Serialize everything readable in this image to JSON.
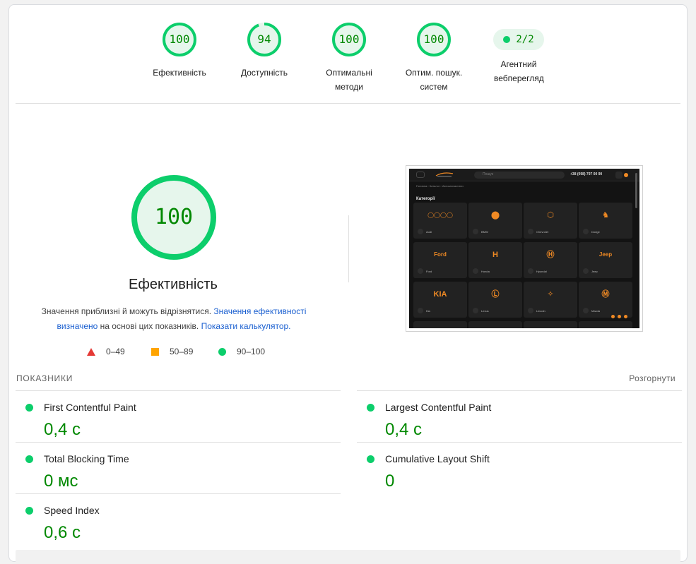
{
  "colors": {
    "pass": "#0cce6b",
    "pass_text": "#008800",
    "average": "#ffa400",
    "fail": "#e53935",
    "link": "#1a5fd0"
  },
  "gauges": [
    {
      "score": "100",
      "label": "Ефективність",
      "progress": 1.0
    },
    {
      "score": "94",
      "label": "Доступність",
      "progress": 0.94
    },
    {
      "score": "100",
      "label": "Оптимальні методи",
      "progress": 1.0
    },
    {
      "score": "100",
      "label": "Оптим. пошук. систем",
      "progress": 1.0
    }
  ],
  "agentic": {
    "value": "2/2",
    "label": "Агентний вебперегляд"
  },
  "main": {
    "score": "100",
    "title": "Ефективність",
    "desc_text1": "Значення приблизні й можуть відрізнятися.",
    "desc_link1": "Значення ефективності визначено",
    "desc_text2": "на основі цих показників.",
    "desc_link2": "Показати калькулятор."
  },
  "legend": {
    "fail": "0–49",
    "average": "50–89",
    "pass": "90–100"
  },
  "thumbnail": {
    "search_placeholder": "Пошук",
    "phone": "+38 (098) 797 00 90",
    "breadcrumb": "Головна › Каталог › Автозапчастини",
    "heading": "Категорії",
    "brands": [
      "Audi",
      "BMW",
      "Chevrolet",
      "Dodge",
      "Ford",
      "Honda",
      "Hyundai",
      "Jeep",
      "Kia",
      "Lexus",
      "Lincoln",
      "Mazda"
    ],
    "logo_text": [
      "◯◯◯◯",
      "⬤",
      "⬡",
      "♞",
      "Ford",
      "H",
      "Ⓗ",
      "Jeep",
      "KIA",
      "Ⓛ",
      "✧",
      "Ⓜ"
    ]
  },
  "metrics": {
    "section_label": "ПОКАЗНИКИ",
    "expand_label": "Розгорнути",
    "items": [
      {
        "name": "First Contentful Paint",
        "value": "0,4 с"
      },
      {
        "name": "Largest Contentful Paint",
        "value": "0,4 с"
      },
      {
        "name": "Total Blocking Time",
        "value": "0 мс"
      },
      {
        "name": "Cumulative Layout Shift",
        "value": "0"
      },
      {
        "name": "Speed Index",
        "value": "0,6 с"
      }
    ]
  }
}
